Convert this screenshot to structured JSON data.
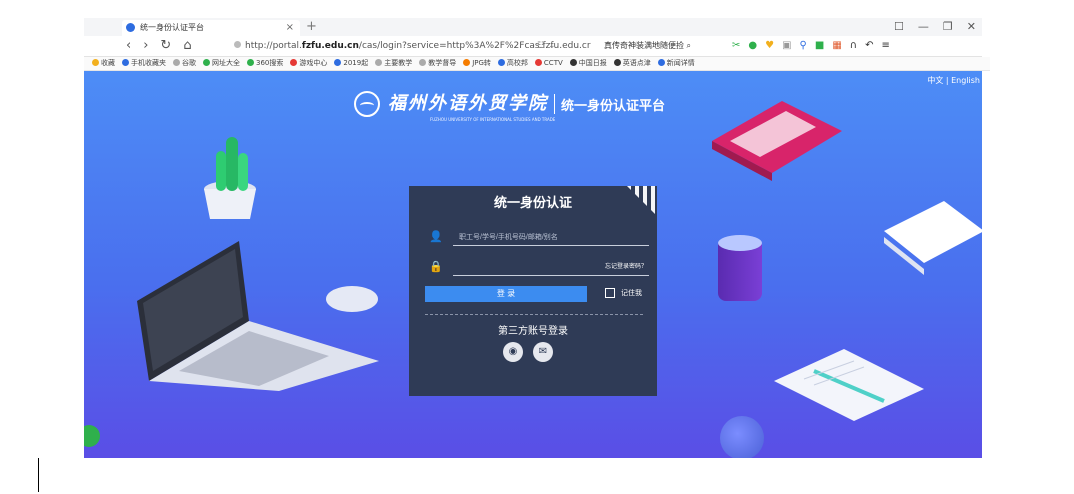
{
  "browser": {
    "tab_title": "统一身份认证平台",
    "tab_close": "×",
    "new_tab": "+",
    "url_prefix": "http://portal.",
    "url_domain": "fzfu.edu.cn",
    "url_rest": "/cas/login?service=http%3A%2F%2Fcas.fzfu.edu.cr",
    "search_hint": "真传奇神装满地随便捡",
    "window_controls": [
      "☐",
      "—",
      "❐",
      "✕"
    ]
  },
  "bookmarks": [
    "收藏",
    "手机收藏夹",
    "谷歌",
    "网址大全",
    "360搜索",
    "游戏中心",
    "2019起",
    "主要教学",
    "教学督导",
    "JPG转",
    "高校邦",
    "CCTV",
    "中国日报",
    "英语点津",
    "新闻详情"
  ],
  "page": {
    "lang_switch": "中文 | English",
    "school_name_cal": "福州外语外贸学院",
    "school_name_en": "FUZHOU UNIVERSITY OF INTERNATIONAL STUDIES AND TRADE",
    "platform_title": "统一身份认证平台"
  },
  "login": {
    "title": "统一身份认证",
    "username_placeholder": "职工号/学号/手机号码/邮箱/别名",
    "forgot_password": "忘记登录密码？",
    "login_button": "登 录",
    "remember_me": "记住我",
    "third_party_title": "第三方账号登录",
    "user_icon": "user-icon",
    "lock_icon": "lock-icon"
  },
  "colors": {
    "accent": "#3c8cf0",
    "card_bg": "#2f3b56",
    "page_bg_top": "#4d8df6",
    "page_bg_bottom": "#5a4ee6"
  }
}
